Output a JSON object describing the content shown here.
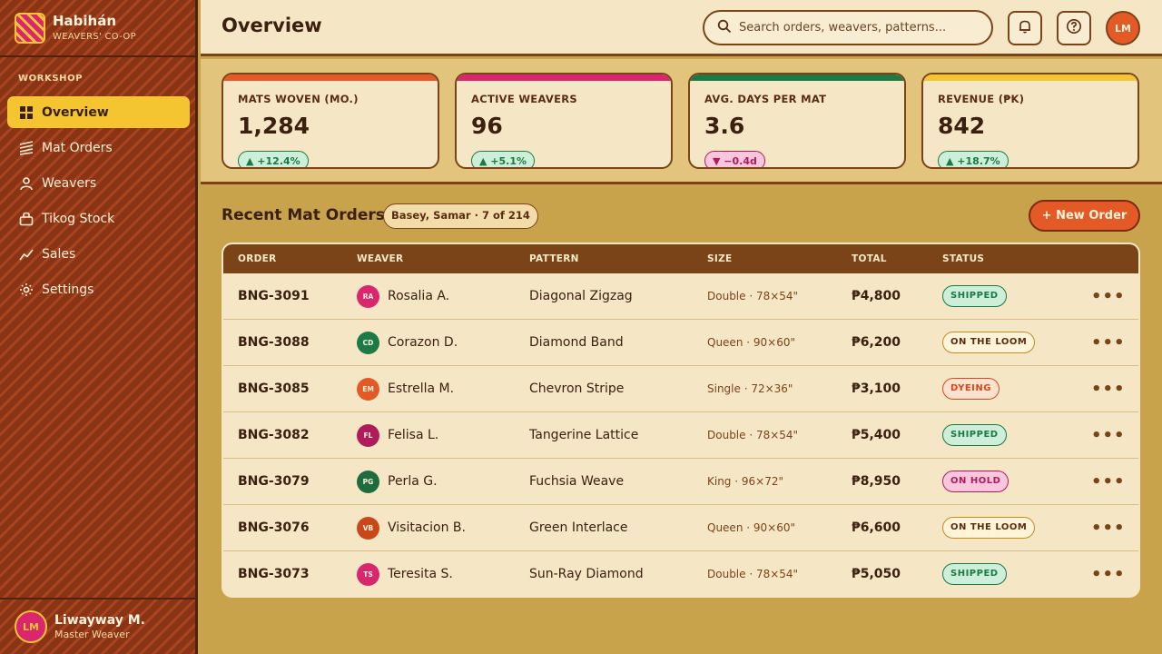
{
  "brand": {
    "name": "Habihán",
    "subtitle": "WEAVERS' CO-OP"
  },
  "sidebar": {
    "section_label": "WORKSHOP",
    "items": [
      {
        "label": "Overview",
        "icon": "grid-icon",
        "active": true
      },
      {
        "label": "Mat Orders",
        "icon": "weave-icon",
        "active": false
      },
      {
        "label": "Weavers",
        "icon": "user-icon",
        "active": false
      },
      {
        "label": "Tikog Stock",
        "icon": "bag-icon",
        "active": false
      },
      {
        "label": "Sales",
        "icon": "trend-icon",
        "active": false
      },
      {
        "label": "Settings",
        "icon": "gear-icon",
        "active": false
      }
    ],
    "user": {
      "initials": "LM",
      "name": "Liwayway M.",
      "role": "Master Weaver"
    }
  },
  "header": {
    "title": "Overview",
    "search_placeholder": "Search orders, weavers, patterns...",
    "avatar_initials": "LM"
  },
  "stats": [
    {
      "label": "MATS WOVEN (MO.)",
      "value": "1,284",
      "delta": "▲ +12.4%",
      "trend": "up",
      "color": "#e35a26"
    },
    {
      "label": "ACTIVE WEAVERS",
      "value": "96",
      "delta": "▲ +5.1%",
      "trend": "up",
      "color": "#d9266e"
    },
    {
      "label": "AVG. DAYS PER MAT",
      "value": "3.6",
      "delta": "▼ −0.4d",
      "trend": "down",
      "color": "#1e7a45"
    },
    {
      "label": "REVENUE (₱K)",
      "value": "842",
      "delta": "▲ +18.7%",
      "trend": "up",
      "color": "#f4c431"
    }
  ],
  "orders": {
    "title": "Recent Mat Orders",
    "filter": "Basey, Samar · 7 of 214",
    "new_button": "+ New Order",
    "columns": [
      "ORDER",
      "WEAVER",
      "PATTERN",
      "SIZE",
      "TOTAL",
      "STATUS"
    ],
    "rows": [
      {
        "order": "BNG-3091",
        "initials": "RA",
        "weaver": "Rosalia A.",
        "avatar_color": "#d9266e",
        "pattern": "Diagonal Zigzag",
        "size": "Double · 78×54\"",
        "total": "₱4,800",
        "status": "SHIPPED",
        "status_type": "shipped"
      },
      {
        "order": "BNG-3088",
        "initials": "CD",
        "weaver": "Corazon D.",
        "avatar_color": "#1e7a45",
        "pattern": "Diamond Band",
        "size": "Queen · 90×60\"",
        "total": "₱6,200",
        "status": "ON THE LOOM",
        "status_type": "loom"
      },
      {
        "order": "BNG-3085",
        "initials": "EM",
        "weaver": "Estrella M.",
        "avatar_color": "#e35a26",
        "pattern": "Chevron Stripe",
        "size": "Single · 72×36\"",
        "total": "₱3,100",
        "status": "DYEING",
        "status_type": "dyeing"
      },
      {
        "order": "BNG-3082",
        "initials": "FL",
        "weaver": "Felisa L.",
        "avatar_color": "#b01b5c",
        "pattern": "Tangerine Lattice",
        "size": "Double · 78×54\"",
        "total": "₱5,400",
        "status": "SHIPPED",
        "status_type": "shipped"
      },
      {
        "order": "BNG-3079",
        "initials": "PG",
        "weaver": "Perla G.",
        "avatar_color": "#1e6b3e",
        "pattern": "Fuchsia Weave",
        "size": "King · 96×72\"",
        "total": "₱8,950",
        "status": "ON HOLD",
        "status_type": "hold"
      },
      {
        "order": "BNG-3076",
        "initials": "VB",
        "weaver": "Visitacion B.",
        "avatar_color": "#c9481a",
        "pattern": "Green Interlace",
        "size": "Queen · 90×60\"",
        "total": "₱6,600",
        "status": "ON THE LOOM",
        "status_type": "loom"
      },
      {
        "order": "BNG-3073",
        "initials": "TS",
        "weaver": "Teresita S.",
        "avatar_color": "#d9266e",
        "pattern": "Sun-Ray Diamond",
        "size": "Double · 78×54\"",
        "total": "₱5,050",
        "status": "SHIPPED",
        "status_type": "shipped"
      }
    ],
    "more_glyph": "•••"
  }
}
